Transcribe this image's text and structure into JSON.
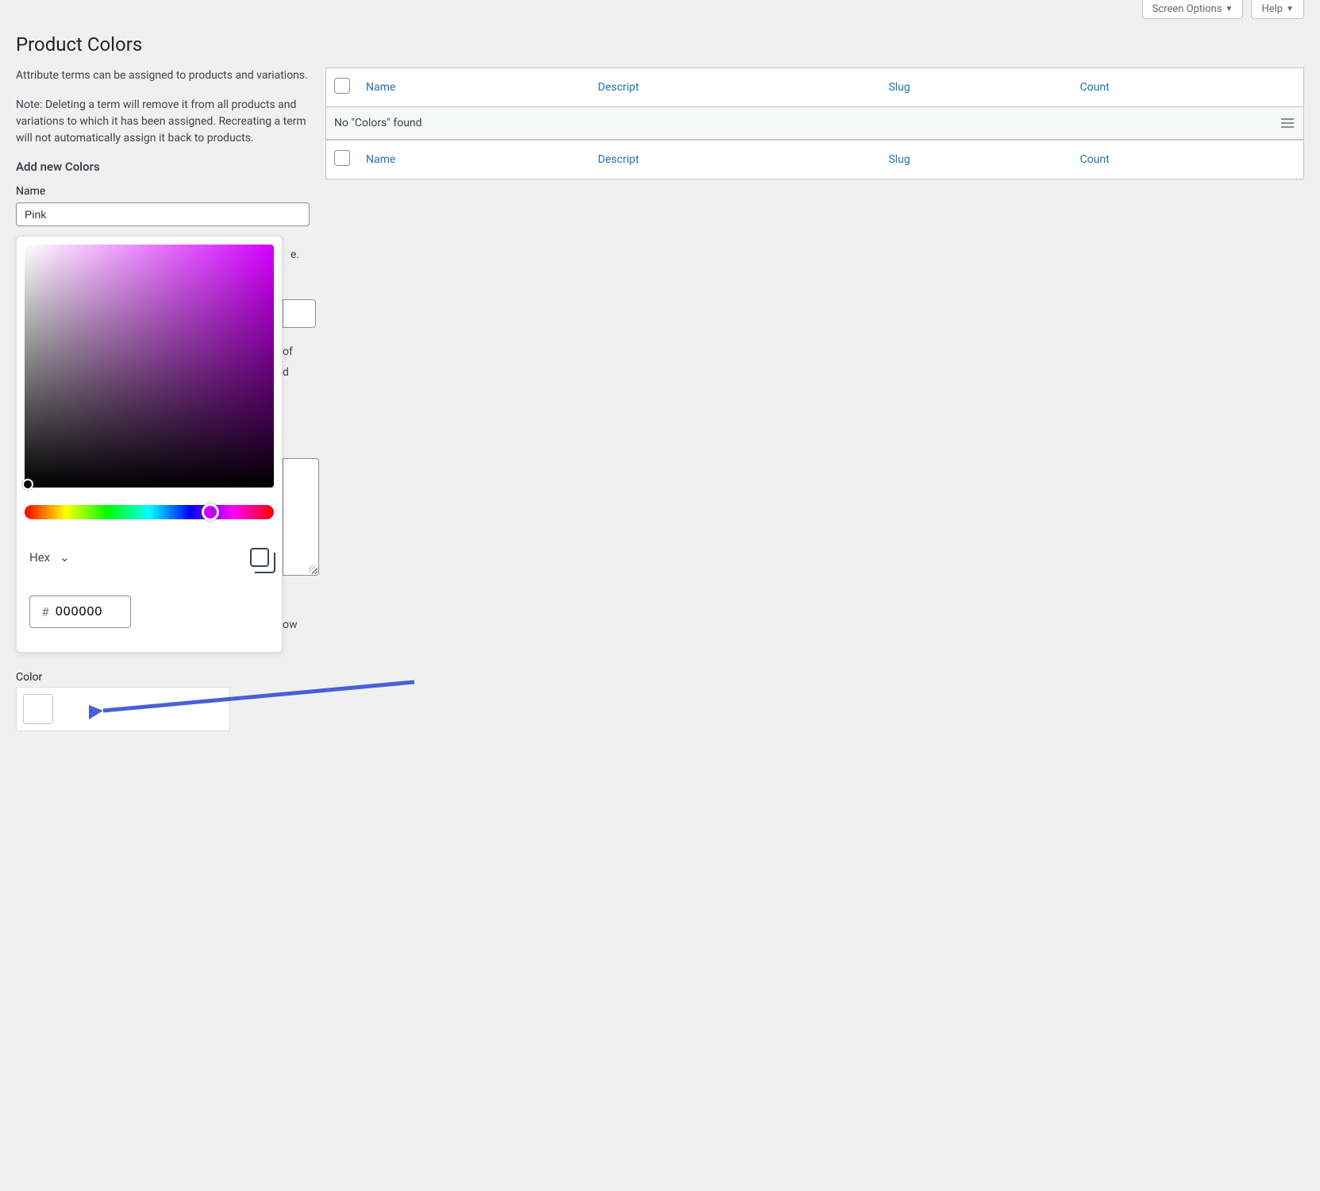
{
  "header": {
    "screen_options": "Screen Options",
    "help": "Help"
  },
  "page_title": "Product Colors",
  "intro_para1": "Attribute terms can be assigned to products and variations.",
  "intro_para2": "Note: Deleting a term will remove it from all products and variations to which it has been assigned. Recreating a term will not automatically assign it back to products.",
  "form": {
    "heading": "Add new Colors",
    "name_label": "Name",
    "name_value": "Pink",
    "color_label": "Color",
    "fragments": {
      "e": "e.",
      "of": "of",
      "d": "d",
      "ow": "ow"
    }
  },
  "picker": {
    "format_label": "Hex",
    "hash": "#",
    "hex_value": "000000"
  },
  "table": {
    "columns": {
      "name": "Name",
      "description": "Descript",
      "slug": "Slug",
      "count": "Count"
    },
    "empty_message": "No \"Colors\" found"
  },
  "colors": {
    "link": "#2271b1",
    "accent": "#d400ff",
    "annotation": "#4a5fd6"
  }
}
